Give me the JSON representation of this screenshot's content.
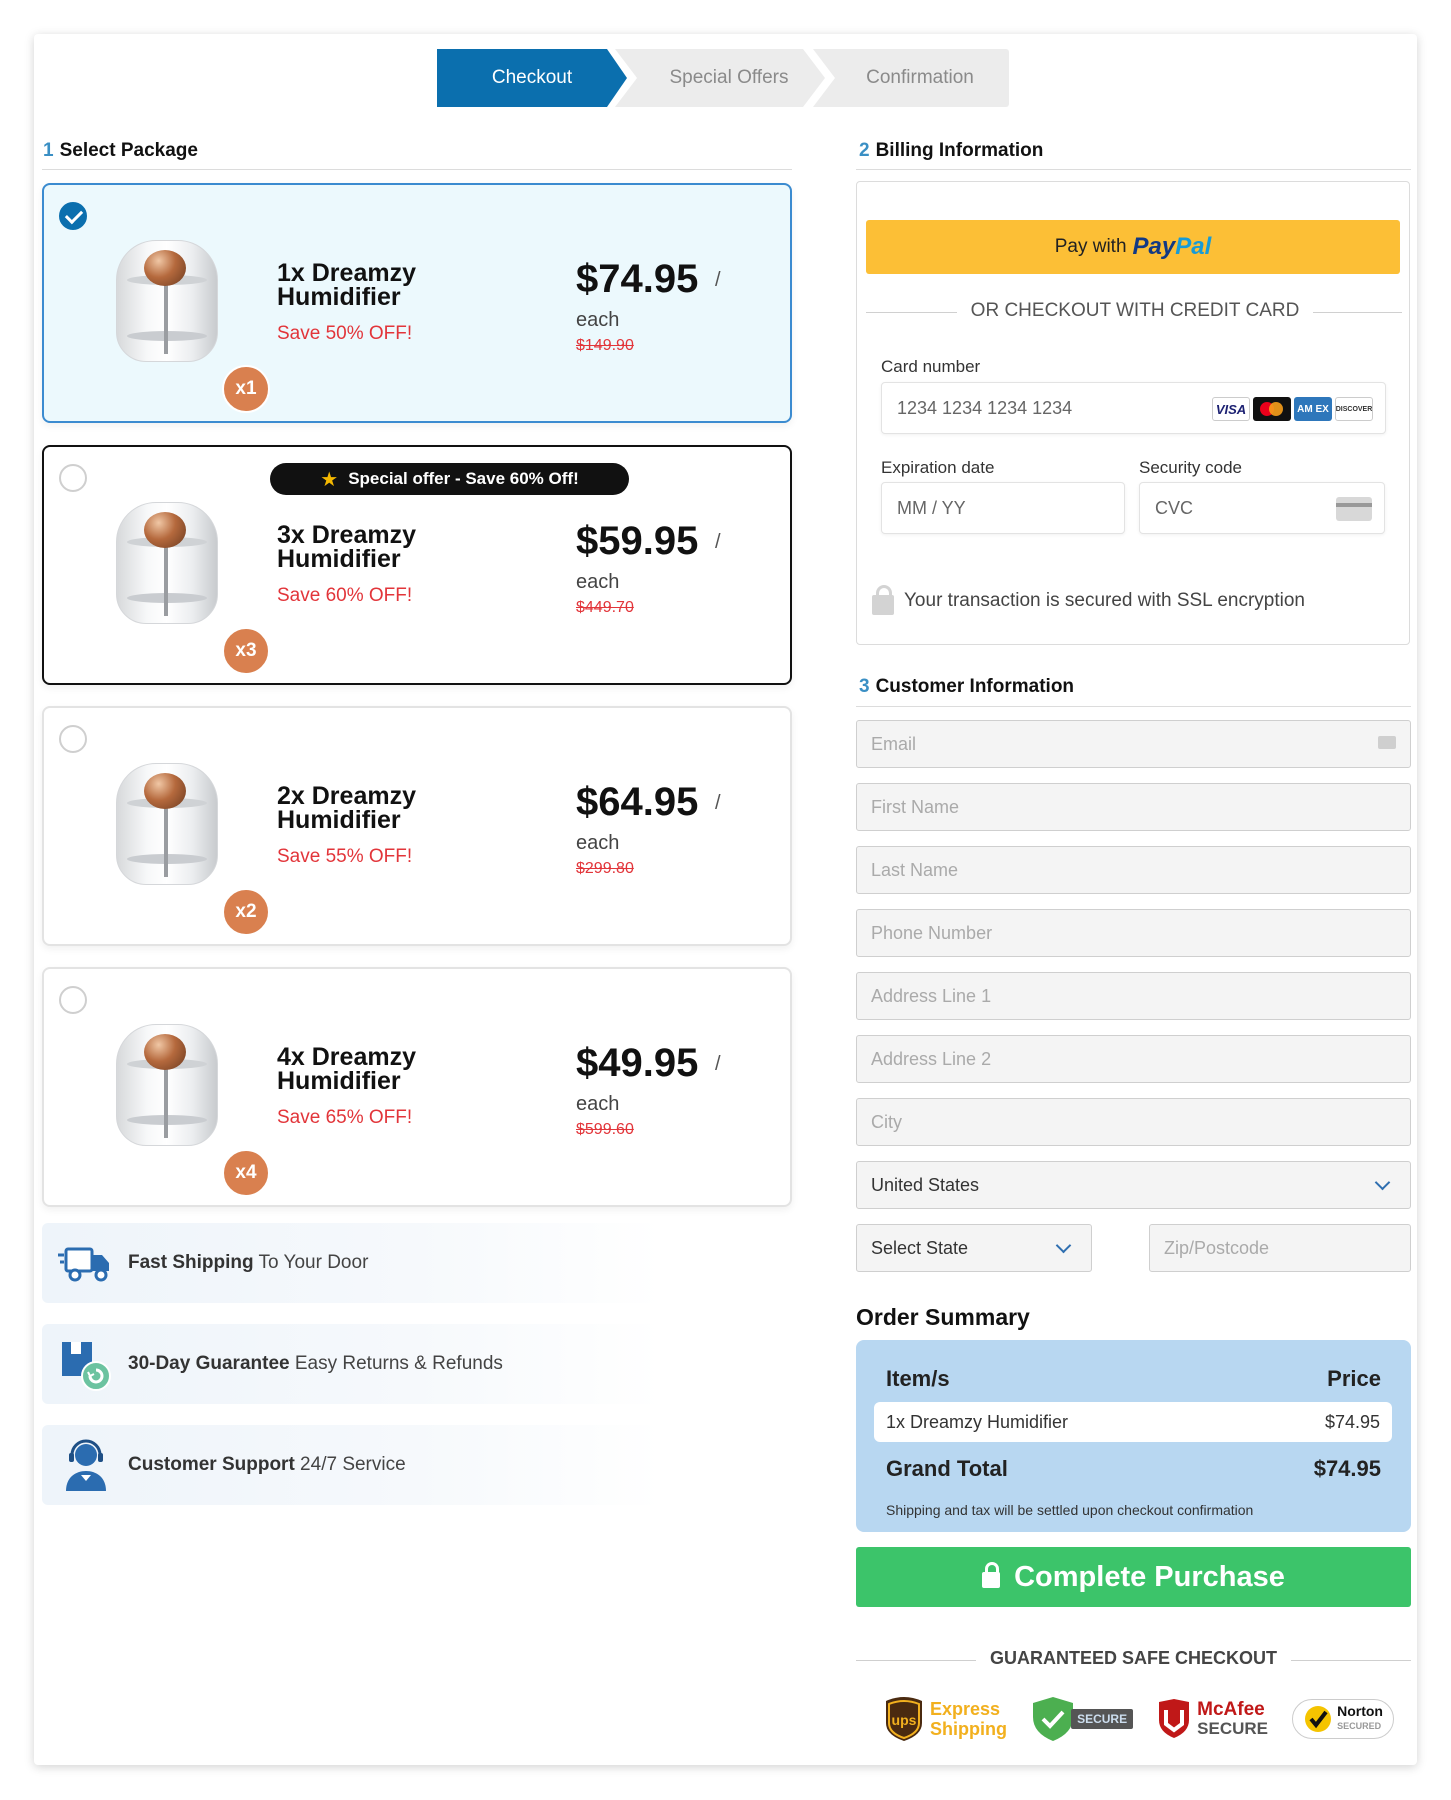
{
  "steps": [
    "Checkout",
    "Special Offers",
    "Confirmation"
  ],
  "sections": {
    "package": {
      "num": "1",
      "title": "Select Package"
    },
    "billing": {
      "num": "2",
      "title": "Billing Information"
    },
    "customer": {
      "num": "3",
      "title": "Customer Information"
    }
  },
  "special_offer_badge": "Special offer - Save 60% Off!",
  "packages": [
    {
      "name": "1x Dreamzy Humidifier",
      "qty": "x1",
      "save": "Save 50% OFF!",
      "price": "$74.95",
      "slash": "/",
      "each": "each",
      "old": "$149.90",
      "selected": true
    },
    {
      "name": "3x Dreamzy Humidifier",
      "qty": "x3",
      "save": "Save 60% OFF!",
      "price": "$59.95",
      "slash": "/",
      "each": "each",
      "old": "$449.70",
      "selected": false
    },
    {
      "name": "2x Dreamzy Humidifier",
      "qty": "x2",
      "save": "Save 55% OFF!",
      "price": "$64.95",
      "slash": "/",
      "each": "each",
      "old": "$299.80",
      "selected": false
    },
    {
      "name": "4x Dreamzy Humidifier",
      "qty": "x4",
      "save": "Save 65% OFF!",
      "price": "$49.95",
      "slash": "/",
      "each": "each",
      "old": "$599.60",
      "selected": false
    }
  ],
  "features": [
    {
      "bold": "Fast Shipping",
      "rest": " To Your Door",
      "icon": "truck-icon"
    },
    {
      "bold": "30-Day Guarantee",
      "rest": " Easy Returns & Refunds",
      "icon": "return-box-icon"
    },
    {
      "bold": "Customer Support",
      "rest": " 24/7 Service",
      "icon": "support-agent-icon"
    }
  ],
  "billing": {
    "paypal_prefix": "Pay with",
    "paypal_pay": "Pay",
    "paypal_pal": "Pal",
    "or_text": "OR CHECKOUT WITH CREDIT CARD",
    "card_label": "Card number",
    "card_placeholder": "1234 1234 1234 1234",
    "card_brands": [
      "VISA",
      "",
      "AM EX",
      "DISCOVER"
    ],
    "exp_label": "Expiration date",
    "exp_placeholder": "MM / YY",
    "cvc_label": "Security code",
    "cvc_placeholder": "CVC",
    "ssl_text": "Your transaction is secured with SSL encryption"
  },
  "customer": {
    "email": "Email",
    "first_name": "First Name",
    "last_name": "Last Name",
    "phone": "Phone Number",
    "address1": "Address Line 1",
    "address2": "Address Line 2",
    "city": "City",
    "country": "United States",
    "state": "Select State",
    "zip": "Zip/Postcode"
  },
  "order_summary": {
    "title": "Order Summary",
    "col_item": "Item/s",
    "col_price": "Price",
    "item_name": "1x Dreamzy Humidifier",
    "item_price": "$74.95",
    "total_label": "Grand Total",
    "total_value": "$74.95",
    "note": "Shipping and tax will be settled upon checkout confirmation"
  },
  "purchase_button": "Complete Purchase",
  "guarantee": {
    "title": "GUARANTEED SAFE CHECKOUT",
    "badges": [
      "ups",
      "Express",
      "Shipping",
      "SECURE",
      "McAfee",
      "SECURE",
      "Norton",
      "SECURED"
    ]
  },
  "colors": {
    "primary": "#0b6fae",
    "accent_red": "#e2353a",
    "buy_green": "#3cc46a",
    "paypal_yellow": "#fcbf36",
    "summary_bg": "#b8d7f1"
  }
}
